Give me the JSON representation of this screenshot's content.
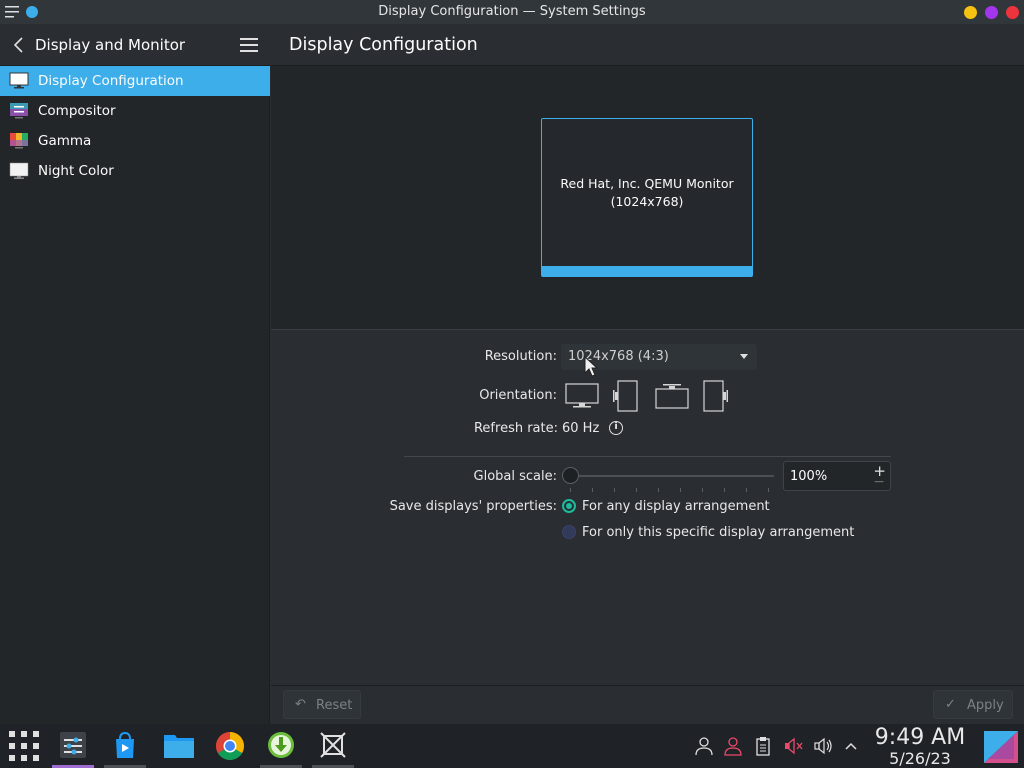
{
  "window": {
    "title": "Display Configuration — System Settings"
  },
  "sidebar": {
    "header_title": "Display and Monitor",
    "items": [
      {
        "label": "Display Configuration",
        "icon": "monitor-icon",
        "active": true
      },
      {
        "label": "Compositor",
        "icon": "compositor-icon"
      },
      {
        "label": "Gamma",
        "icon": "gamma-icon"
      },
      {
        "label": "Night Color",
        "icon": "night-color-icon"
      }
    ]
  },
  "main": {
    "title": "Display Configuration",
    "monitor": {
      "name": "Red Hat, Inc. QEMU Monitor",
      "resolution": "(1024x768)"
    },
    "resolution_label": "Resolution:",
    "resolution_value": "1024x768 (4:3)",
    "orientation_label": "Orientation:",
    "refresh_label": "Refresh rate:",
    "refresh_value": "60 Hz",
    "scale_label": "Global scale:",
    "scale_value": "100%",
    "save_label": "Save displays' properties:",
    "save_options": [
      {
        "label": "For any display arrangement",
        "checked": true
      },
      {
        "label": "For only this specific display arrangement",
        "checked": false
      }
    ]
  },
  "buttons": {
    "reset": "Reset",
    "apply": "Apply"
  },
  "taskbar": {
    "time": "9:49 AM",
    "date": "5/26/23",
    "apps": [
      "app-launcher-icon",
      "system-settings-icon",
      "discover-icon",
      "files-icon",
      "chrome-icon",
      "downloader-icon",
      "window-manager-icon"
    ]
  },
  "colors": {
    "accent": "#3daee9",
    "radio_checked": "#1abc9c",
    "active_task": "#9f6dd1"
  }
}
